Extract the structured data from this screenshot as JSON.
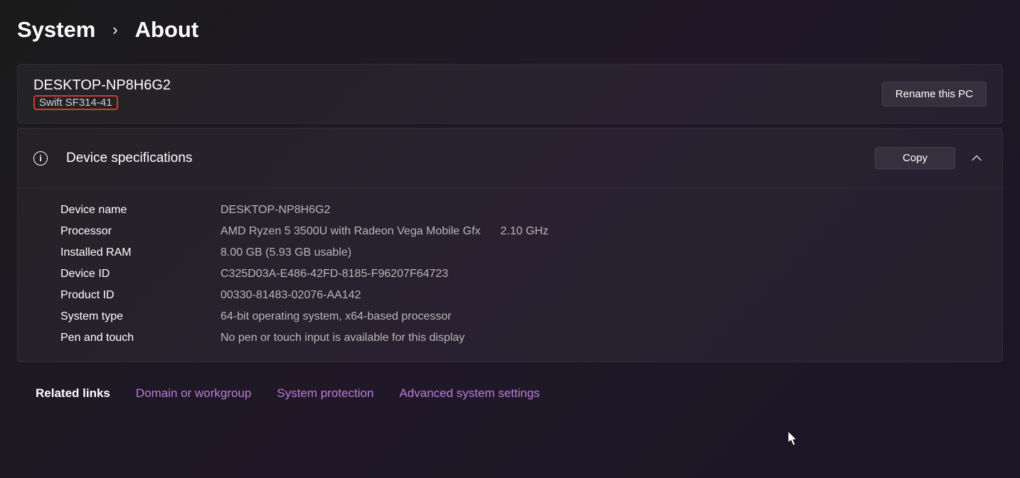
{
  "breadcrumb": {
    "parent": "System",
    "separator": "›",
    "current": "About"
  },
  "pc": {
    "name": "DESKTOP-NP8H6G2",
    "model": "Swift SF314-41",
    "rename_label": "Rename this PC"
  },
  "specs": {
    "title": "Device specifications",
    "copy_label": "Copy",
    "rows": [
      {
        "label": "Device name",
        "value": "DESKTOP-NP8H6G2"
      },
      {
        "label": "Processor",
        "value": "AMD Ryzen 5 3500U with Radeon Vega Mobile Gfx",
        "extra": "2.10 GHz"
      },
      {
        "label": "Installed RAM",
        "value": "8.00 GB (5.93 GB usable)"
      },
      {
        "label": "Device ID",
        "value": "C325D03A-E486-42FD-8185-F96207F64723"
      },
      {
        "label": "Product ID",
        "value": "00330-81483-02076-AA142"
      },
      {
        "label": "System type",
        "value": "64-bit operating system, x64-based processor"
      },
      {
        "label": "Pen and touch",
        "value": "No pen or touch input is available for this display"
      }
    ]
  },
  "related": {
    "title": "Related links",
    "links": [
      "Domain or workgroup",
      "System protection",
      "Advanced system settings"
    ]
  }
}
